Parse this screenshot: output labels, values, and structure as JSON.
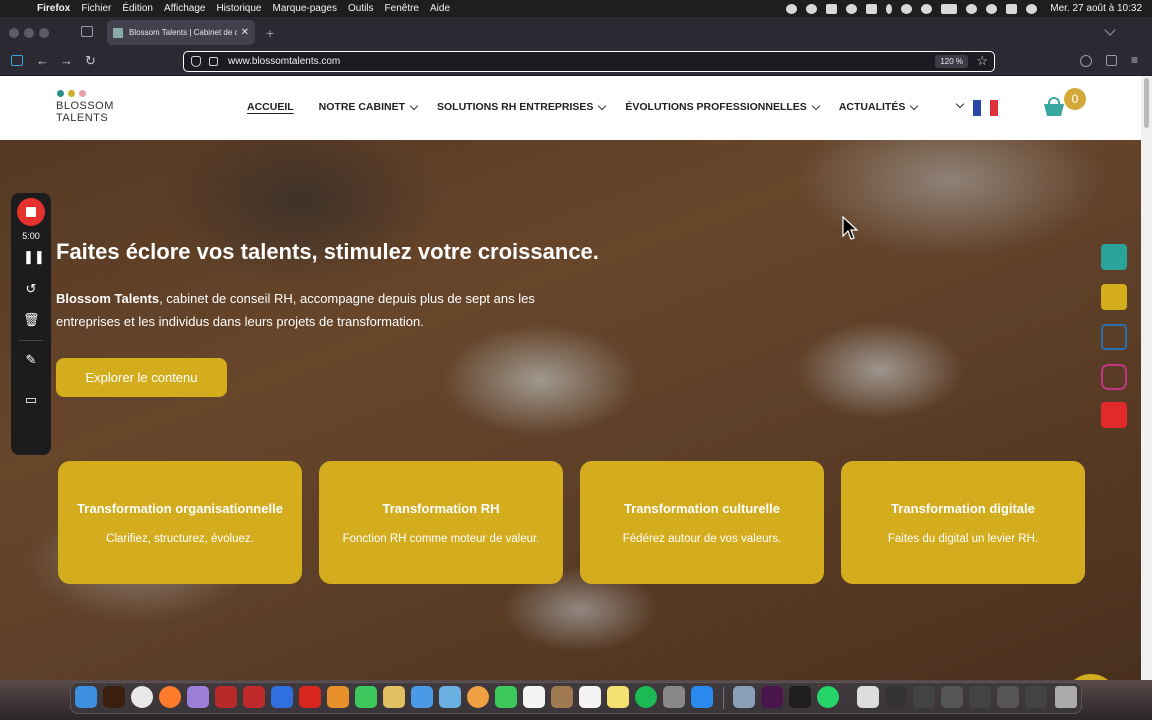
{
  "menubar": {
    "app": "Firefox",
    "items": [
      "Fichier",
      "Édition",
      "Affichage",
      "Historique",
      "Marque-pages",
      "Outils",
      "Fenêtre",
      "Aide"
    ],
    "clock": "Mer. 27 août à  10:32"
  },
  "browser": {
    "tab_title": "Blossom Talents | Cabinet de co",
    "url": "www.blossomtalents.com",
    "zoom": "120 %"
  },
  "site": {
    "logo": {
      "line1": "BLOSSOM",
      "line2": "TALENTS",
      "dot_colors": [
        "#2a8f87",
        "#c9b22a",
        "#e8a0a8"
      ]
    },
    "nav": [
      {
        "label": "ACCUEIL",
        "active": true
      },
      {
        "label": "NOTRE CABINET",
        "dropdown": true
      },
      {
        "label": "SOLUTIONS RH ENTREPRISES",
        "dropdown": true
      },
      {
        "label": "ÉVOLUTIONS PROFESSIONNELLES",
        "dropdown": true
      },
      {
        "label": "ACTUALITÉS",
        "dropdown": true
      }
    ],
    "cart_count": "0",
    "accent_color": "#d4ad1f",
    "hero": {
      "title": "Faites éclore vos talents, stimulez votre croissance.",
      "desc_bold": "Blossom Talents",
      "desc_rest": ", cabinet de conseil RH, accompagne depuis plus de sept ans les entreprises et les individus dans leurs projets de transformation.",
      "cta": "Explorer le contenu"
    },
    "cards": [
      {
        "title": "Transformation organisationnelle",
        "subtitle": "Clarifiez, structurez, évoluez."
      },
      {
        "title": "Transformation RH",
        "subtitle": "Fonction RH comme moteur de valeur."
      },
      {
        "title": "Transformation culturelle",
        "subtitle": "Fédérez autour de vos valeurs."
      },
      {
        "title": "Transformation digitale",
        "subtitle": "Faites du digital un levier RH."
      }
    ],
    "social": [
      "phone-icon",
      "calendar-icon",
      "linkedin-icon",
      "instagram-icon",
      "youtube-icon"
    ]
  },
  "recorder": {
    "time": "5:00"
  }
}
